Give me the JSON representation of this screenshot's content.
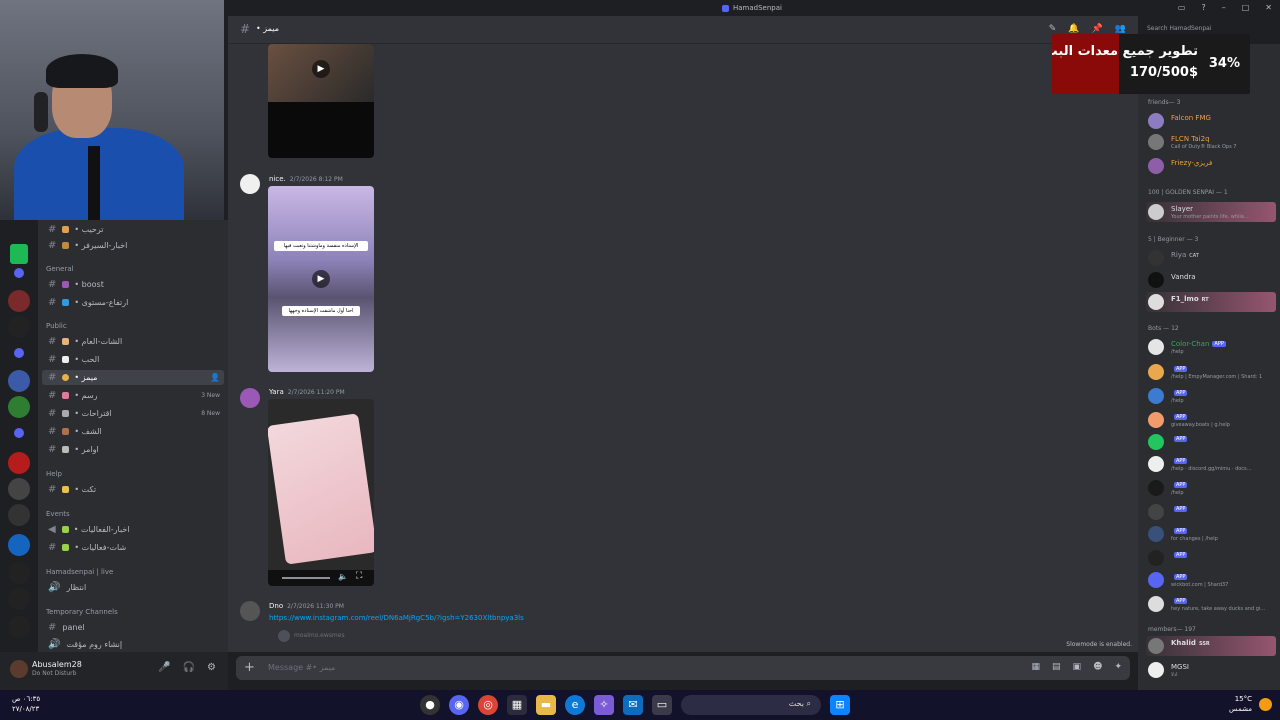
{
  "window": {
    "title": "HamadSenpai"
  },
  "header": {
    "channel_name": "• ميمز",
    "search_placeholder": "Search HamadSenpai"
  },
  "donation": {
    "title": "تطوير جميع معدات البث",
    "amount": "170/500$",
    "percent_label": "34%",
    "progress": 0.34
  },
  "sidebar": {
    "top_channels": [
      {
        "label": "• ترحيب",
        "new": ""
      },
      {
        "label": "• اخبار-السيرفر",
        "new": ""
      }
    ],
    "categories": [
      {
        "label": "General",
        "channels": [
          {
            "label": "• boost",
            "new": ""
          },
          {
            "label": "• ارتفاع-مستوى",
            "new": ""
          }
        ]
      },
      {
        "label": "Public",
        "channels": [
          {
            "label": "• الشات-العام",
            "new": ""
          },
          {
            "label": "• الحب",
            "new": ""
          },
          {
            "label": "• ميمز",
            "new": "",
            "active": true
          },
          {
            "label": "• رسم",
            "new": "3 New"
          },
          {
            "label": "• اقتراحات",
            "new": "8 New"
          },
          {
            "label": "• الشف",
            "new": ""
          },
          {
            "label": "• اوامر",
            "new": ""
          }
        ]
      },
      {
        "label": "Help",
        "channels": [
          {
            "label": "• تكت",
            "new": ""
          }
        ]
      },
      {
        "label": "Events",
        "channels": [
          {
            "label": "• اخبار-الفعاليات",
            "new": ""
          },
          {
            "label": "• شات-فعاليات",
            "new": ""
          }
        ]
      },
      {
        "label": "Hamadsenpai | live",
        "channels": [
          {
            "label": "انتظار",
            "new": ""
          }
        ]
      },
      {
        "label": "Temporary Channels",
        "channels": [
          {
            "label": "panel",
            "new": ""
          },
          {
            "label": "إنشاء روم مؤقت",
            "new": ""
          }
        ]
      }
    ]
  },
  "server_badge": {
    "number": "8"
  },
  "user": {
    "name": "Abusalem28",
    "status": "Do Not Disturb"
  },
  "messages": [
    {
      "author": "nice.",
      "time": "2/7/2026 8:12 PM",
      "caption_top": "الإستاذه منفسة وماوشتنا وتعبت فيها",
      "caption_bottom": "احنا أول ماشفت الإستاذه وجهها"
    },
    {
      "author": "Yara",
      "time": "2/7/2026 11:20 PM"
    },
    {
      "author": "Dno",
      "time": "2/7/2026 11:30 PM",
      "link": "https://www.instagram.com/reel/DN6aMjRgC5b/?igsh=Y2630Xltbnpya3ls",
      "reply": "moalmo.ewsmes"
    }
  ],
  "composer": {
    "placeholder": "Message #• ميمز"
  },
  "slowmode": {
    "label": "Slowmode is enabled."
  },
  "member_list": {
    "groups": [
      {
        "label": "friends— 3",
        "members": [
          {
            "name": "Falcon FMG",
            "sub": "",
            "badge": ""
          },
          {
            "name": "FLCN Tai2q",
            "sub": "Call of Duty® Black Ops 7",
            "badge": ""
          },
          {
            "name": "Friezy-فريزي",
            "sub": "",
            "badge": ""
          }
        ]
      },
      {
        "label": "100 | GOLDEN SENPAI — 1",
        "members": [
          {
            "name": "Slayer",
            "sub": "Your mother paints life, while...",
            "badge": ""
          }
        ]
      },
      {
        "label": "5 | Beginner — 3",
        "members": [
          {
            "name": "Riya",
            "sub": "",
            "badge": "CAT"
          },
          {
            "name": "Vandra",
            "sub": "",
            "badge": ""
          },
          {
            "name": "F1_lmo",
            "sub": "",
            "badge": "RT"
          }
        ]
      },
      {
        "label": "Bots — 12",
        "members": [
          {
            "name": "Color-Chan",
            "sub": "/help",
            "badge": "APP"
          },
          {
            "name": "",
            "sub": "/help | EmpyManager.com | Shard: 1",
            "badge": "APP"
          },
          {
            "name": "",
            "sub": "/help",
            "badge": "APP"
          },
          {
            "name": "",
            "sub": "giveaway.boats | g.help",
            "badge": "APP"
          },
          {
            "name": "",
            "sub": "",
            "badge": "APP"
          },
          {
            "name": "",
            "sub": "/help · discord.gg/mimu · docs...",
            "badge": "APP"
          },
          {
            "name": "",
            "sub": "/help",
            "badge": "APP"
          },
          {
            "name": "",
            "sub": "",
            "badge": "APP"
          },
          {
            "name": "",
            "sub": "for changes | /help",
            "badge": "APP"
          },
          {
            "name": "",
            "sub": "",
            "badge": "APP"
          },
          {
            "name": "",
            "sub": "wickbot.com | Shard37",
            "badge": "APP"
          },
          {
            "name": "",
            "sub": "hey nature, take away ducks and gi...",
            "badge": "APP"
          }
        ]
      },
      {
        "label": "members— 197",
        "members": [
          {
            "name": "Khalid",
            "sub": "",
            "badge": "SSR"
          },
          {
            "name": "MGSI",
            "sub": "ادلا",
            "badge": ""
          }
        ]
      }
    ]
  },
  "taskbar": {
    "time": "٠٦:٣٥ ص",
    "date": "٢٧/٠٨/٢٣",
    "search_placeholder": "بحث",
    "weather_temp": "15°C",
    "weather_desc": "مشمس"
  },
  "colors": {
    "accent": "#5865f2",
    "donation_fill": "#8a0a0a",
    "bg": "#313338"
  }
}
